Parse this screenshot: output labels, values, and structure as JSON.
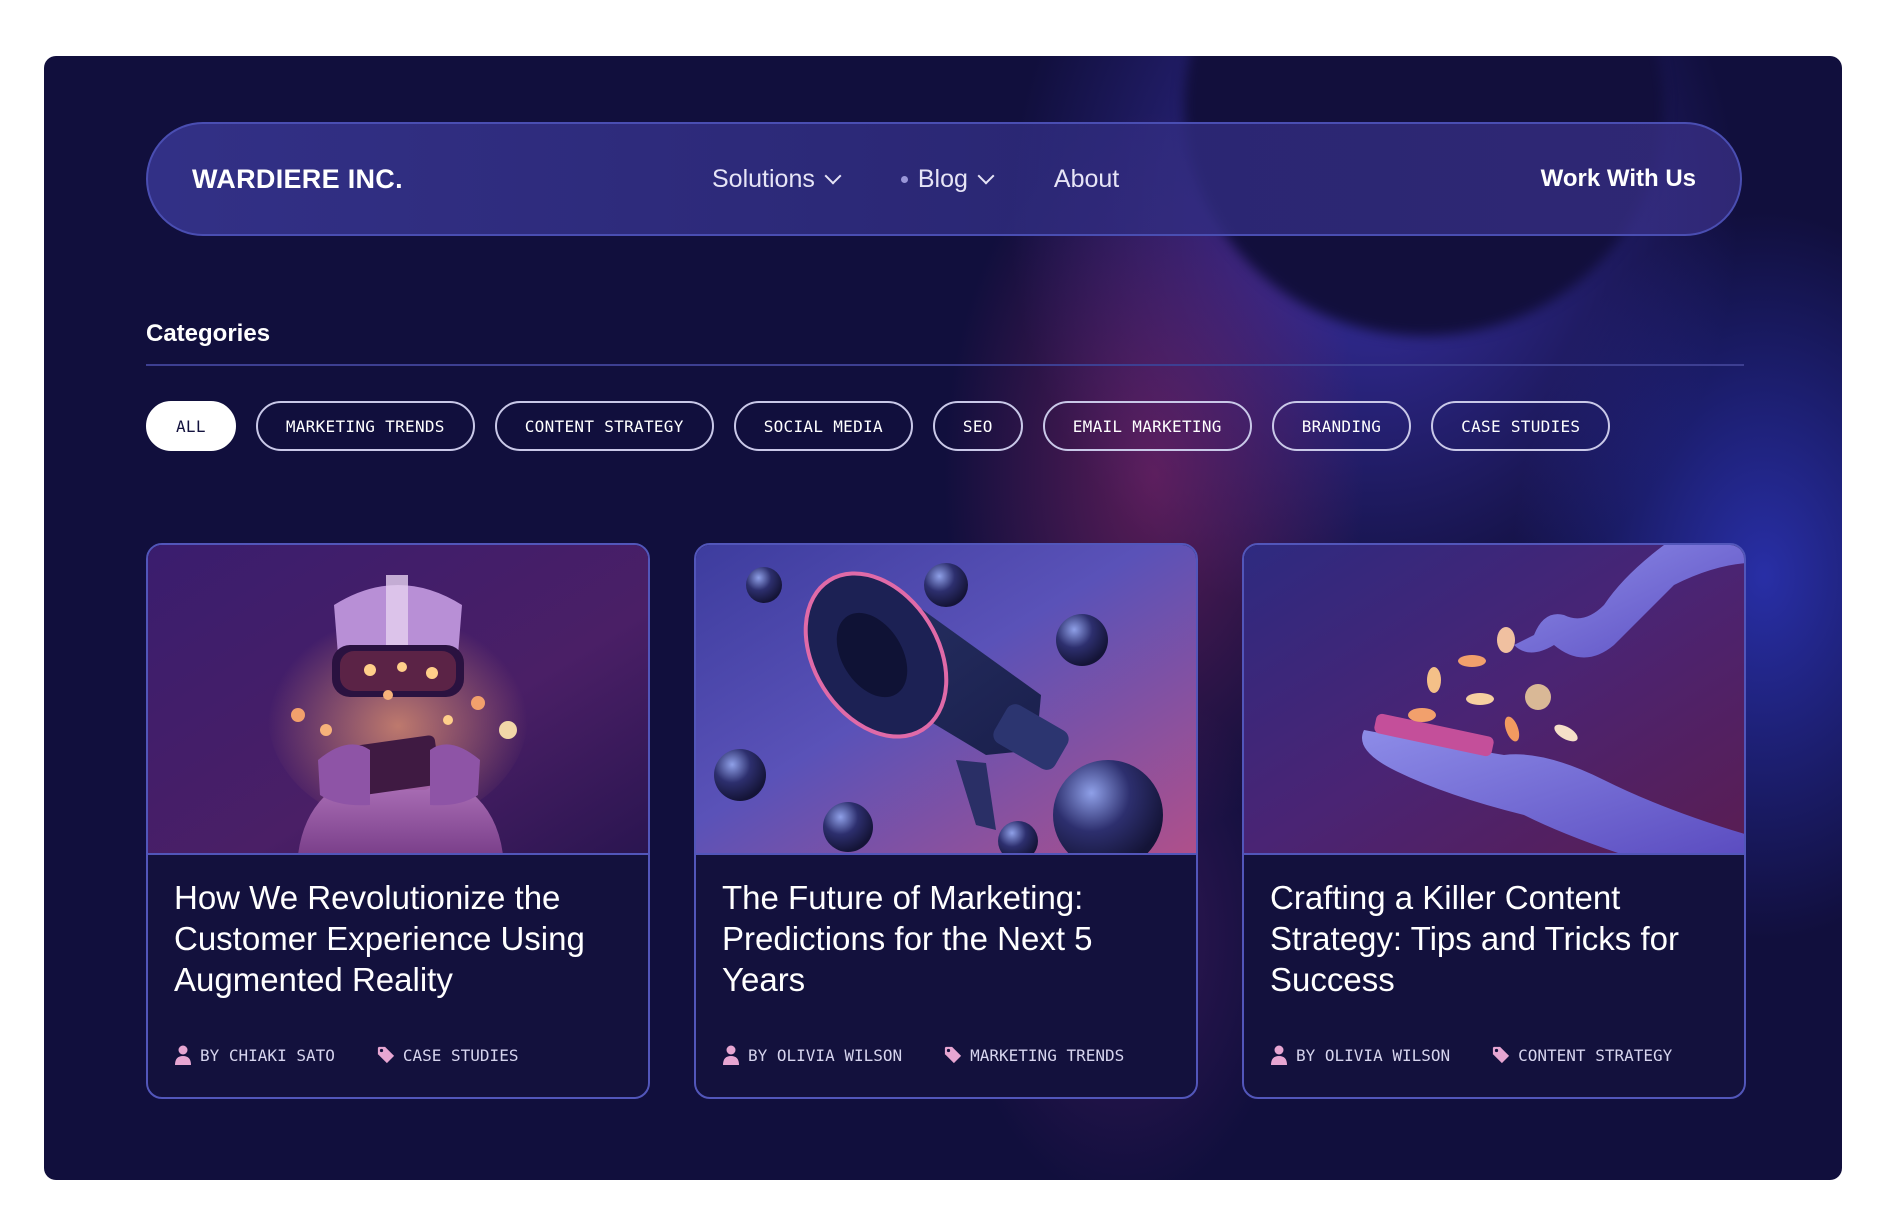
{
  "nav": {
    "logo": "WARDIERE INC.",
    "items": [
      {
        "label": "Solutions",
        "has_dropdown": true,
        "active": false
      },
      {
        "label": "Blog",
        "has_dropdown": true,
        "active": true
      },
      {
        "label": "About",
        "has_dropdown": false,
        "active": false
      }
    ],
    "cta": "Work With Us"
  },
  "categories": {
    "title": "Categories",
    "chips": [
      {
        "label": "ALL",
        "active": true
      },
      {
        "label": "MARKETING TRENDS",
        "active": false
      },
      {
        "label": "CONTENT STRATEGY",
        "active": false
      },
      {
        "label": "SOCIAL MEDIA",
        "active": false
      },
      {
        "label": "SEO",
        "active": false
      },
      {
        "label": "EMAIL MARKETING",
        "active": false
      },
      {
        "label": "BRANDING",
        "active": false
      },
      {
        "label": "CASE STUDIES",
        "active": false
      }
    ]
  },
  "posts": [
    {
      "title": "How We Revolutionize the Customer Experience Using Augmented Reality",
      "author": "BY CHIAKI SATO",
      "category": "CASE STUDIES",
      "image": "vr-headset-illustration"
    },
    {
      "title": "The Future of Marketing: Predictions for the Next 5 Years",
      "author": "BY OLIVIA WILSON",
      "category": "MARKETING TRENDS",
      "image": "megaphone-illustration"
    },
    {
      "title": "Crafting a Killer Content Strategy: Tips and Tricks for Success",
      "author": "BY OLIVIA WILSON",
      "category": "CONTENT STRATEGY",
      "image": "hands-coins-illustration"
    }
  ],
  "colors": {
    "background": "#110f3d",
    "accent_border": "#5256ba",
    "icon_pink": "#e7a6d2"
  }
}
